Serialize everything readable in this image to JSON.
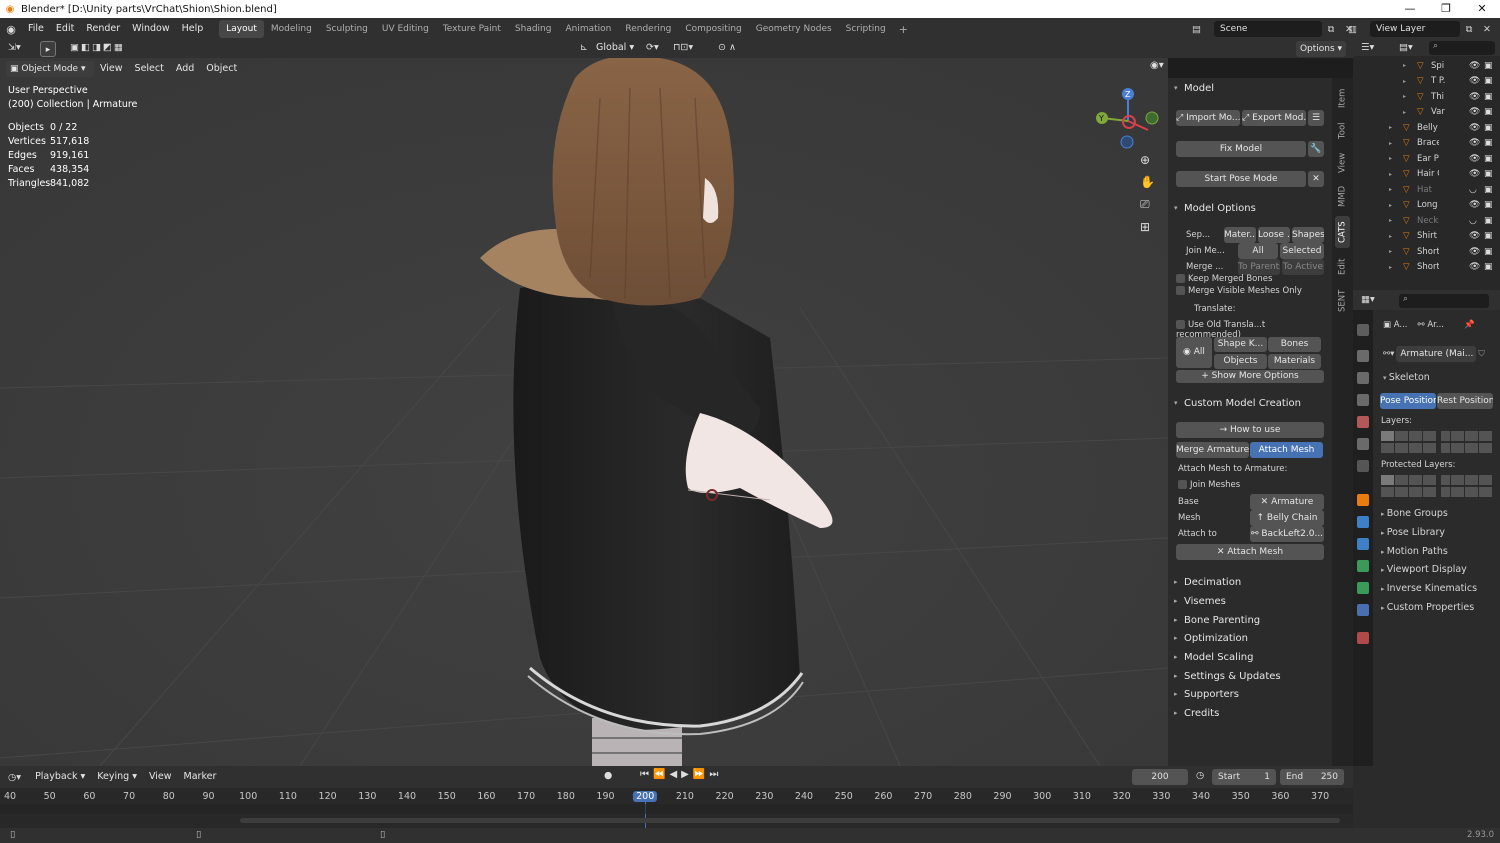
{
  "window": {
    "title": "Blender* [D:\\Unity parts\\VrChat\\Shion\\Shion.blend]",
    "controls": [
      "—",
      "❐",
      "✕"
    ]
  },
  "menu": [
    "File",
    "Edit",
    "Render",
    "Window",
    "Help"
  ],
  "workspaces": [
    "Layout",
    "Modeling",
    "Sculpting",
    "UV Editing",
    "Texture Paint",
    "Shading",
    "Animation",
    "Rendering",
    "Compositing",
    "Geometry Nodes",
    "Scripting"
  ],
  "active_workspace": "Layout",
  "scene": {
    "name": "Scene",
    "view_layer": "View Layer"
  },
  "header2": {
    "transform_orientation": "Global",
    "options": "Options"
  },
  "viewport": {
    "mode": "Object Mode",
    "menus": [
      "View",
      "Select",
      "Add",
      "Object"
    ],
    "overlay_title": "User Perspective",
    "overlay_subtitle": "(200) Collection | Armature",
    "stats": [
      {
        "label": "Objects",
        "value": "0 / 22"
      },
      {
        "label": "Vertices",
        "value": "517,618"
      },
      {
        "label": "Edges",
        "value": "919,161"
      },
      {
        "label": "Faces",
        "value": "438,354"
      },
      {
        "label": "Triangles",
        "value": "841,082"
      }
    ]
  },
  "npanel": {
    "model": {
      "title": "Model",
      "import": "Import Mo...",
      "export": "Export Mod...",
      "fix": "Fix Model",
      "pose": "Start Pose Mode"
    },
    "options": {
      "title": "Model Options",
      "sep": "Sep...",
      "sep_btns": [
        "Mater...",
        "Loose ...",
        "Shapes"
      ],
      "join": "Join Me...",
      "join_btns": [
        "All",
        "Selected"
      ],
      "merge": "Merge ...",
      "merge_btns": [
        "To Parents",
        "To Active"
      ],
      "keep_bones": "Keep Merged Bones",
      "visible_only": "Merge Visible Meshes Only",
      "translate": "Translate:",
      "old_translate": "Use Old Transla...t recommended)",
      "all": "All",
      "translate_btns": [
        "Shape K...",
        "Bones",
        "Objects",
        "Materials"
      ],
      "more": "Show More Options"
    },
    "custom": {
      "title": "Custom Model Creation",
      "how": "How to use",
      "merge_arm": "Merge Armatures",
      "attach_tab": "Attach Mesh",
      "attach_label": "Attach Mesh to Armature:",
      "join": "Join Meshes",
      "base_label": "Base",
      "base_val": "Armature",
      "mesh_label": "Mesh",
      "mesh_val": "Belly Chain",
      "attach_to_label": "Attach to",
      "attach_to_val": "BackLeft2.0...",
      "attach_btn": "Attach Mesh"
    },
    "collapsed": [
      "Decimation",
      "Visemes",
      "Bone Parenting",
      "Optimization",
      "Model Scaling",
      "Settings & Updates",
      "Supporters",
      "Credits"
    ]
  },
  "vtabs": [
    "Item",
    "Tool",
    "View",
    "MMD",
    "CATS",
    "Edit",
    "SENT"
  ],
  "active_vtab": "CATS",
  "outliner": [
    {
      "name": "Spi",
      "exp": "▸",
      "indent": 1,
      "vis": true
    },
    {
      "name": "T P.",
      "exp": "▸",
      "indent": 1,
      "vis": true
    },
    {
      "name": "Thi",
      "exp": "▸",
      "indent": 1,
      "vis": true
    },
    {
      "name": "Var",
      "exp": "▸",
      "indent": 1,
      "vis": true
    },
    {
      "name": "Belly Cl",
      "exp": "▸",
      "indent": 0,
      "vis": true
    },
    {
      "name": "Bracele",
      "exp": "▸",
      "indent": 0,
      "vis": true
    },
    {
      "name": "Ear P",
      "exp": "▸",
      "indent": 0,
      "vis": true
    },
    {
      "name": "Hair Cli",
      "exp": "▸",
      "indent": 0,
      "vis": true
    },
    {
      "name": "Hat",
      "exp": "▸",
      "indent": 0,
      "vis": false
    },
    {
      "name": "Long Sl",
      "exp": "▸",
      "indent": 0,
      "vis": true
    },
    {
      "name": "Necklac",
      "exp": "▸",
      "indent": 0,
      "vis": false
    },
    {
      "name": "Shirt",
      "exp": "▸",
      "indent": 0,
      "vis": true
    },
    {
      "name": "Shorts",
      "exp": "▸",
      "indent": 0,
      "vis": true
    },
    {
      "name": "Shorts C",
      "exp": "▸",
      "indent": 0,
      "vis": true
    }
  ],
  "properties": {
    "crumb_a": "A...",
    "crumb_b": "Ar...",
    "datablock": "Armature (Mai...",
    "skeleton": "Skeleton",
    "pose_position": "Pose Position",
    "rest_position": "Rest Position",
    "layers": "Layers:",
    "protected": "Protected Layers:",
    "sections": [
      "Bone Groups",
      "Pose Library",
      "Motion Paths",
      "Viewport Display",
      "Inverse Kinematics",
      "Custom Properties"
    ]
  },
  "timeline": {
    "menus": [
      "Playback",
      "Keying",
      "View",
      "Marker"
    ],
    "current_frame": "200",
    "start_label": "Start",
    "start": "1",
    "end_label": "End",
    "end": "250",
    "ticks": [
      "40",
      "50",
      "60",
      "70",
      "80",
      "90",
      "100",
      "110",
      "120",
      "130",
      "140",
      "150",
      "160",
      "170",
      "180",
      "190",
      "200",
      "210",
      "220",
      "230",
      "240",
      "250",
      "260",
      "270",
      "280",
      "290",
      "300",
      "310",
      "320",
      "330",
      "340",
      "350",
      "360",
      "370"
    ],
    "current_tick": "200"
  },
  "status": {
    "version": "2.93.0"
  },
  "colors": {
    "accent": "#4772b3",
    "playhead": "#4772b3",
    "orange": "#e87d0d"
  }
}
